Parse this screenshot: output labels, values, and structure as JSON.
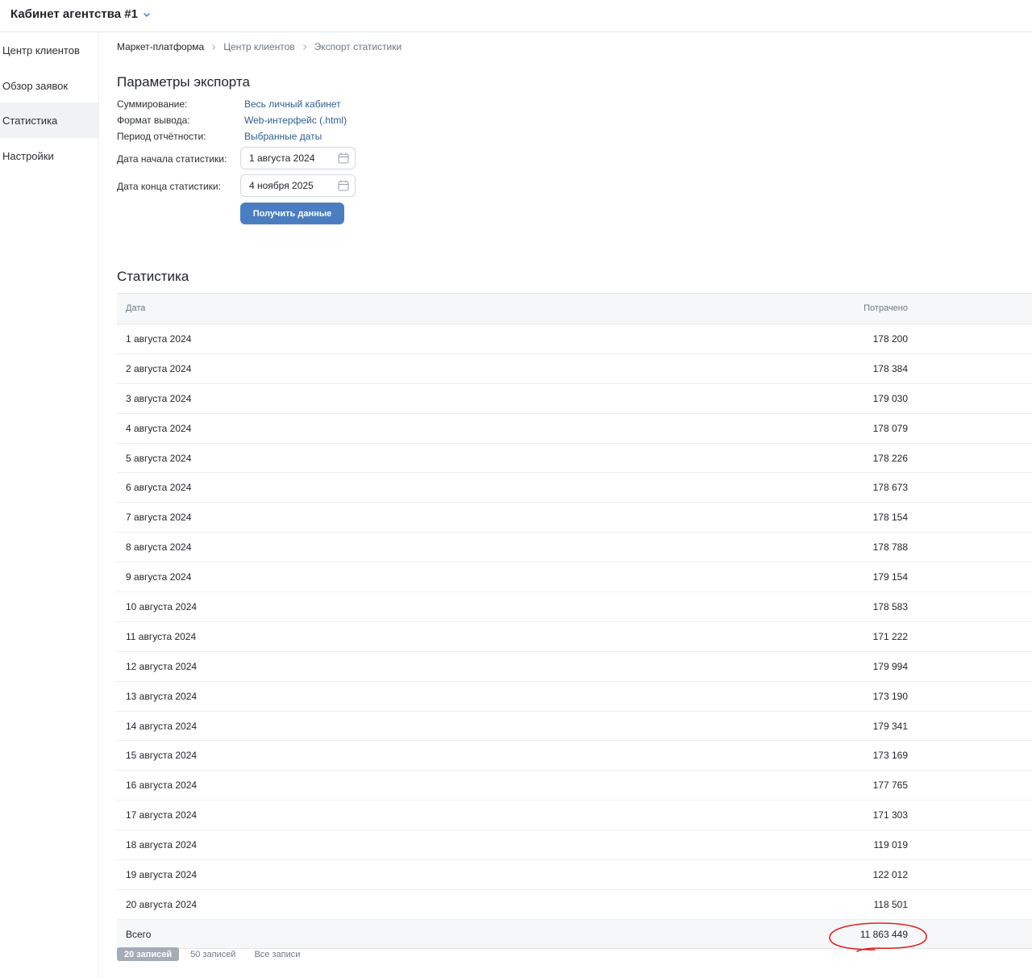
{
  "header": {
    "cabinet_title": "Кабинет агентства #1"
  },
  "sidebar": {
    "items": [
      {
        "label": "Центр клиентов"
      },
      {
        "label": "Обзор заявок"
      },
      {
        "label": "Статистика"
      },
      {
        "label": "Настройки"
      }
    ]
  },
  "breadcrumb": [
    "Маркет-платформа",
    "Центр клиентов",
    "Экспорт статистики"
  ],
  "export_params": {
    "title": "Параметры экспорта",
    "summation_label": "Суммирование:",
    "summation_value": "Весь личный кабинет",
    "format_label": "Формат вывода:",
    "format_value": "Web-интерфейс (.html)",
    "period_label": "Период отчётности:",
    "period_value": "Выбранные даты",
    "start_label": "Дата начала статистики:",
    "start_value": "1 августа 2024",
    "end_label": "Дата конца статистики:",
    "end_value": "4 ноября 2025",
    "submit_label": "Получить данные"
  },
  "statistics": {
    "title": "Статистика",
    "columns": {
      "date": "Дата",
      "spent": "Потрачено"
    },
    "rows": [
      {
        "date": "1 августа 2024",
        "spent": "178 200"
      },
      {
        "date": "2 августа 2024",
        "spent": "178 384"
      },
      {
        "date": "3 августа 2024",
        "spent": "179 030"
      },
      {
        "date": "4 августа 2024",
        "spent": "178 079"
      },
      {
        "date": "5 августа 2024",
        "spent": "178 226"
      },
      {
        "date": "6 августа 2024",
        "spent": "178 673"
      },
      {
        "date": "7 августа 2024",
        "spent": "178 154"
      },
      {
        "date": "8 августа 2024",
        "spent": "178 788"
      },
      {
        "date": "9 августа 2024",
        "spent": "179 154"
      },
      {
        "date": "10 августа 2024",
        "spent": "178 583"
      },
      {
        "date": "11 августа 2024",
        "spent": "171 222"
      },
      {
        "date": "12 августа 2024",
        "spent": "179 994"
      },
      {
        "date": "13 августа 2024",
        "spent": "173 190"
      },
      {
        "date": "14 августа 2024",
        "spent": "179 341"
      },
      {
        "date": "15 августа 2024",
        "spent": "173 169"
      },
      {
        "date": "16 августа 2024",
        "spent": "177 765"
      },
      {
        "date": "17 августа 2024",
        "spent": "171 303"
      },
      {
        "date": "18 августа 2024",
        "spent": "119 019"
      },
      {
        "date": "19 августа 2024",
        "spent": "122 012"
      },
      {
        "date": "20 августа 2024",
        "spent": "118 501"
      }
    ],
    "total_label": "Всего",
    "total_value": "11 863 449",
    "highlight_color": "#e02020"
  },
  "pagination": {
    "options": [
      "20 записей",
      "50 записей",
      "Все записи"
    ],
    "selected": "20 записей"
  },
  "colors": {
    "accent": "#4a7ec0",
    "link": "#2f5f92"
  }
}
